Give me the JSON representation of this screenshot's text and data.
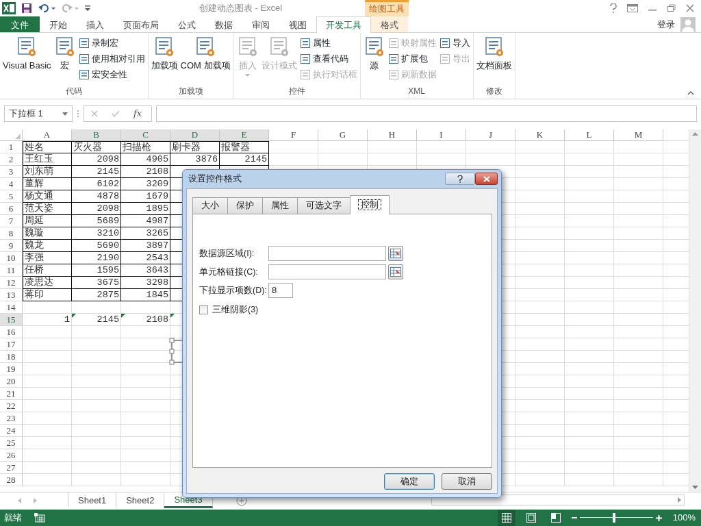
{
  "window": {
    "title": "创建动态图表 - Excel",
    "contextual_group": "绘图工具"
  },
  "ribbon_tabs": [
    {
      "label": "文件",
      "kind": "file",
      "selected": false
    },
    {
      "label": "开始",
      "kind": "normal",
      "selected": false
    },
    {
      "label": "插入",
      "kind": "normal",
      "selected": false
    },
    {
      "label": "页面布局",
      "kind": "normal",
      "selected": false
    },
    {
      "label": "公式",
      "kind": "normal",
      "selected": false
    },
    {
      "label": "数据",
      "kind": "normal",
      "selected": false
    },
    {
      "label": "审阅",
      "kind": "normal",
      "selected": false
    },
    {
      "label": "视图",
      "kind": "normal",
      "selected": false
    },
    {
      "label": "开发工具",
      "kind": "normal",
      "selected": true
    },
    {
      "label": "格式",
      "kind": "contextual",
      "selected": false
    }
  ],
  "sign_in": "登录",
  "ribbon_groups": [
    {
      "label": "代码",
      "items": [
        {
          "kind": "large",
          "label": "Visual Basic",
          "disabled": false
        },
        {
          "kind": "large",
          "label": "宏",
          "disabled": false
        },
        {
          "kind": "small",
          "label": "录制宏",
          "disabled": false
        },
        {
          "kind": "small",
          "label": "使用相对引用",
          "disabled": false
        },
        {
          "kind": "small",
          "label": "宏安全性",
          "disabled": false
        }
      ]
    },
    {
      "label": "加载项",
      "items": [
        {
          "kind": "large",
          "label": "加载项",
          "disabled": false
        },
        {
          "kind": "large",
          "label": "COM 加载项",
          "disabled": false
        }
      ]
    },
    {
      "label": "控件",
      "items": [
        {
          "kind": "large",
          "label": "插入",
          "disabled": true,
          "dropdown": true
        },
        {
          "kind": "large",
          "label": "设计模式",
          "disabled": true
        },
        {
          "kind": "small",
          "label": "属性",
          "disabled": false
        },
        {
          "kind": "small",
          "label": "查看代码",
          "disabled": false
        },
        {
          "kind": "small",
          "label": "执行对话框",
          "disabled": true
        }
      ]
    },
    {
      "label": "XML",
      "items": [
        {
          "kind": "large",
          "label": "源",
          "disabled": false
        },
        {
          "kind": "small",
          "label": "映射属性",
          "disabled": true
        },
        {
          "kind": "small",
          "label": "扩展包",
          "disabled": false
        },
        {
          "kind": "small",
          "label": "刷新数据",
          "disabled": true
        },
        {
          "kind": "small",
          "label": "导入",
          "disabled": false
        },
        {
          "kind": "small",
          "label": "导出",
          "disabled": true
        }
      ]
    },
    {
      "label": "修改",
      "items": [
        {
          "kind": "large",
          "label": "文档面板",
          "disabled": false
        }
      ]
    }
  ],
  "formula_bar": {
    "name_box": "下拉框 1",
    "function_button": "fx"
  },
  "columns": [
    {
      "label": "A",
      "highlighted": false
    },
    {
      "label": "B",
      "highlighted": true
    },
    {
      "label": "C",
      "highlighted": true
    },
    {
      "label": "D",
      "highlighted": true
    },
    {
      "label": "E",
      "highlighted": true
    },
    {
      "label": "F",
      "highlighted": false
    },
    {
      "label": "G",
      "highlighted": false
    },
    {
      "label": "H",
      "highlighted": false
    },
    {
      "label": "I",
      "highlighted": false
    },
    {
      "label": "J",
      "highlighted": false
    },
    {
      "label": "K",
      "highlighted": false
    },
    {
      "label": "L",
      "highlighted": false
    },
    {
      "label": "M",
      "highlighted": false
    }
  ],
  "rows": [
    {
      "number": "1",
      "highlighted": false,
      "kind": "header",
      "cells": [
        "姓名",
        "灭火器",
        "扫描枪",
        "刷卡器",
        "报警器"
      ]
    },
    {
      "number": "2",
      "highlighted": false,
      "kind": "record",
      "cells": [
        "王红玉",
        "2098",
        "4905",
        "3876",
        "2145"
      ]
    },
    {
      "number": "3",
      "highlighted": false,
      "kind": "record",
      "cells": [
        "刘东萌",
        "2145",
        "2108"
      ]
    },
    {
      "number": "4",
      "highlighted": false,
      "kind": "record",
      "cells": [
        "董辉",
        "6102",
        "3209"
      ]
    },
    {
      "number": "5",
      "highlighted": false,
      "kind": "record",
      "cells": [
        "杨文通",
        "4878",
        "1679"
      ]
    },
    {
      "number": "6",
      "highlighted": false,
      "kind": "record",
      "cells": [
        "范天姿",
        "2098",
        "1895"
      ]
    },
    {
      "number": "7",
      "highlighted": false,
      "kind": "record",
      "cells": [
        "周延",
        "5689",
        "4987"
      ]
    },
    {
      "number": "8",
      "highlighted": false,
      "kind": "record",
      "cells": [
        "魏璇",
        "3210",
        "3265"
      ]
    },
    {
      "number": "9",
      "highlighted": false,
      "kind": "record",
      "cells": [
        "魏龙",
        "5690",
        "3897"
      ]
    },
    {
      "number": "10",
      "highlighted": false,
      "kind": "record",
      "cells": [
        "李强",
        "2190",
        "2543"
      ]
    },
    {
      "number": "11",
      "highlighted": false,
      "kind": "record",
      "cells": [
        "任桥",
        "1595",
        "3643"
      ]
    },
    {
      "number": "12",
      "highlighted": false,
      "kind": "record",
      "cells": [
        "凌思达",
        "3675",
        "3298"
      ]
    },
    {
      "number": "13",
      "highlighted": false,
      "kind": "record",
      "cells": [
        "蒋印",
        "2875",
        "1845"
      ]
    },
    {
      "number": "14",
      "highlighted": false,
      "kind": "blank"
    },
    {
      "number": "15",
      "highlighted": true,
      "kind": "calc",
      "cells": [
        {
          "value": "1"
        },
        {
          "value": "2145",
          "flag": true
        },
        {
          "value": "2108",
          "flag": true
        },
        {
          "flag": true
        }
      ]
    },
    {
      "number": "16",
      "highlighted": false,
      "kind": "blank"
    },
    {
      "number": "17",
      "highlighted": false,
      "kind": "blank"
    },
    {
      "number": "18",
      "highlighted": false,
      "kind": "blank"
    },
    {
      "number": "19",
      "highlighted": false,
      "kind": "blank"
    },
    {
      "number": "20",
      "highlighted": false,
      "kind": "blank"
    },
    {
      "number": "21",
      "highlighted": false,
      "kind": "blank"
    },
    {
      "number": "22",
      "highlighted": false,
      "kind": "blank"
    },
    {
      "number": "23",
      "highlighted": false,
      "kind": "blank"
    },
    {
      "number": "24",
      "highlighted": false,
      "kind": "blank"
    },
    {
      "number": "25",
      "highlighted": false,
      "kind": "blank"
    },
    {
      "number": "26",
      "highlighted": false,
      "kind": "blank"
    },
    {
      "number": "27",
      "highlighted": false,
      "kind": "blank"
    },
    {
      "number": "28",
      "highlighted": false,
      "kind": "blank"
    }
  ],
  "sheet_tabs": [
    {
      "label": "Sheet1",
      "selected": false
    },
    {
      "label": "Sheet2",
      "selected": false
    },
    {
      "label": "Sheet3",
      "selected": true
    }
  ],
  "status_bar": {
    "text": "就绪",
    "views": [
      {
        "kind": "normal",
        "selected": true
      },
      {
        "kind": "page_layout",
        "selected": false
      },
      {
        "kind": "page_break",
        "selected": false
      }
    ],
    "zoom": {
      "level": 0.47,
      "label": "100%"
    }
  },
  "dialog": {
    "title": "设置控件格式",
    "tabs": [
      {
        "label": "大小",
        "selected": false
      },
      {
        "label": "保护",
        "selected": false
      },
      {
        "label": "属性",
        "selected": false
      },
      {
        "label": "可选文字",
        "selected": false
      },
      {
        "label": "控制",
        "selected": true
      }
    ],
    "fields": [
      {
        "label": "数据源区域(I):",
        "kind": "range"
      },
      {
        "label": "单元格链接(C):",
        "kind": "range"
      },
      {
        "label": "下拉显示项数(D):",
        "kind": "number",
        "value": "8"
      }
    ],
    "checkbox": {
      "label": "三维阴影(3)",
      "checked": false
    },
    "buttons": [
      {
        "label": "确定",
        "default": true
      },
      {
        "label": "取消",
        "default": false
      }
    ]
  }
}
